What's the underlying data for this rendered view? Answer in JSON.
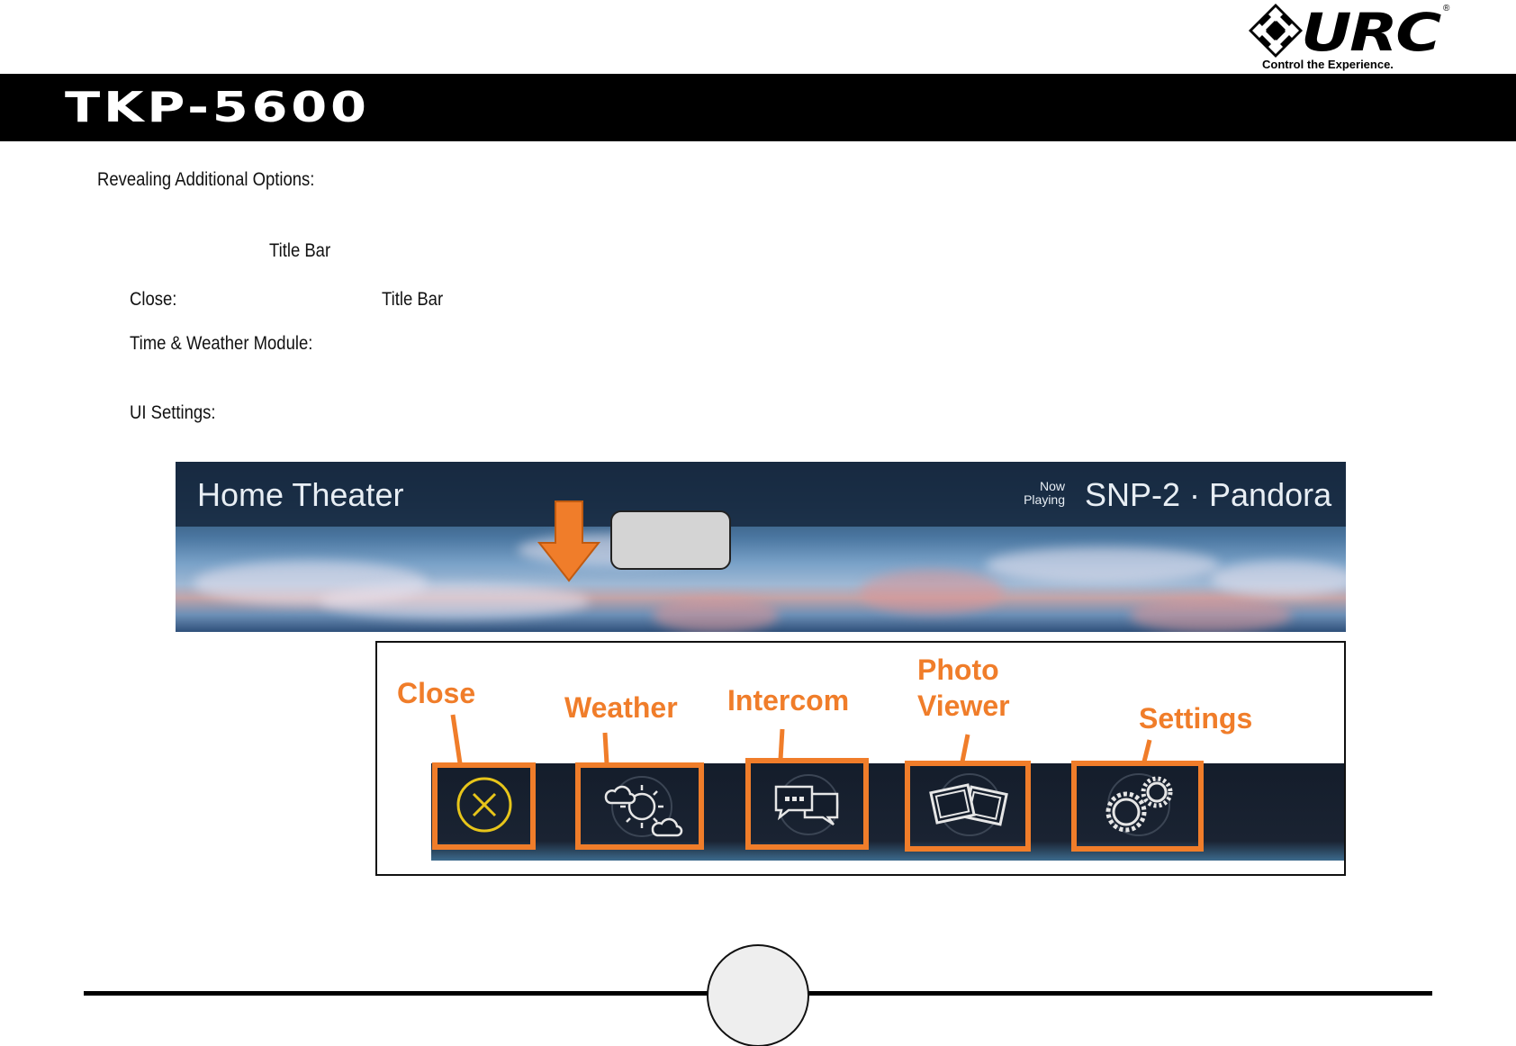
{
  "logo": {
    "letters": "URC",
    "registered": "®",
    "tagline": "Control the Experience."
  },
  "header": {
    "title": "TKP-5600"
  },
  "content": {
    "section_heading": "Revealing Additional Options:",
    "title_bar_ref_1": "Title Bar",
    "close_label": "Close:",
    "title_bar_ref_2": "Title Bar",
    "time_weather_label": "Time & Weather Module:",
    "ui_settings_label": "UI Settings:"
  },
  "titlebar_screen": {
    "room_name": "Home Theater",
    "now_playing": "Now Playing",
    "source": "SNP-2 · Pandora"
  },
  "icon_panel": {
    "labels": {
      "close": "Close",
      "weather": "Weather",
      "intercom": "Intercom",
      "photo_viewer_line1": "Photo",
      "photo_viewer_line2": "Viewer",
      "settings": "Settings"
    },
    "icons": [
      "close-circle-icon",
      "weather-sun-cloud-icon",
      "intercom-chat-icon",
      "photo-viewer-icon",
      "settings-gears-icon"
    ]
  },
  "colors": {
    "accent_orange": "#f07d2a",
    "close_icon_yellow": "#e7c51a",
    "header_black": "#000000"
  }
}
